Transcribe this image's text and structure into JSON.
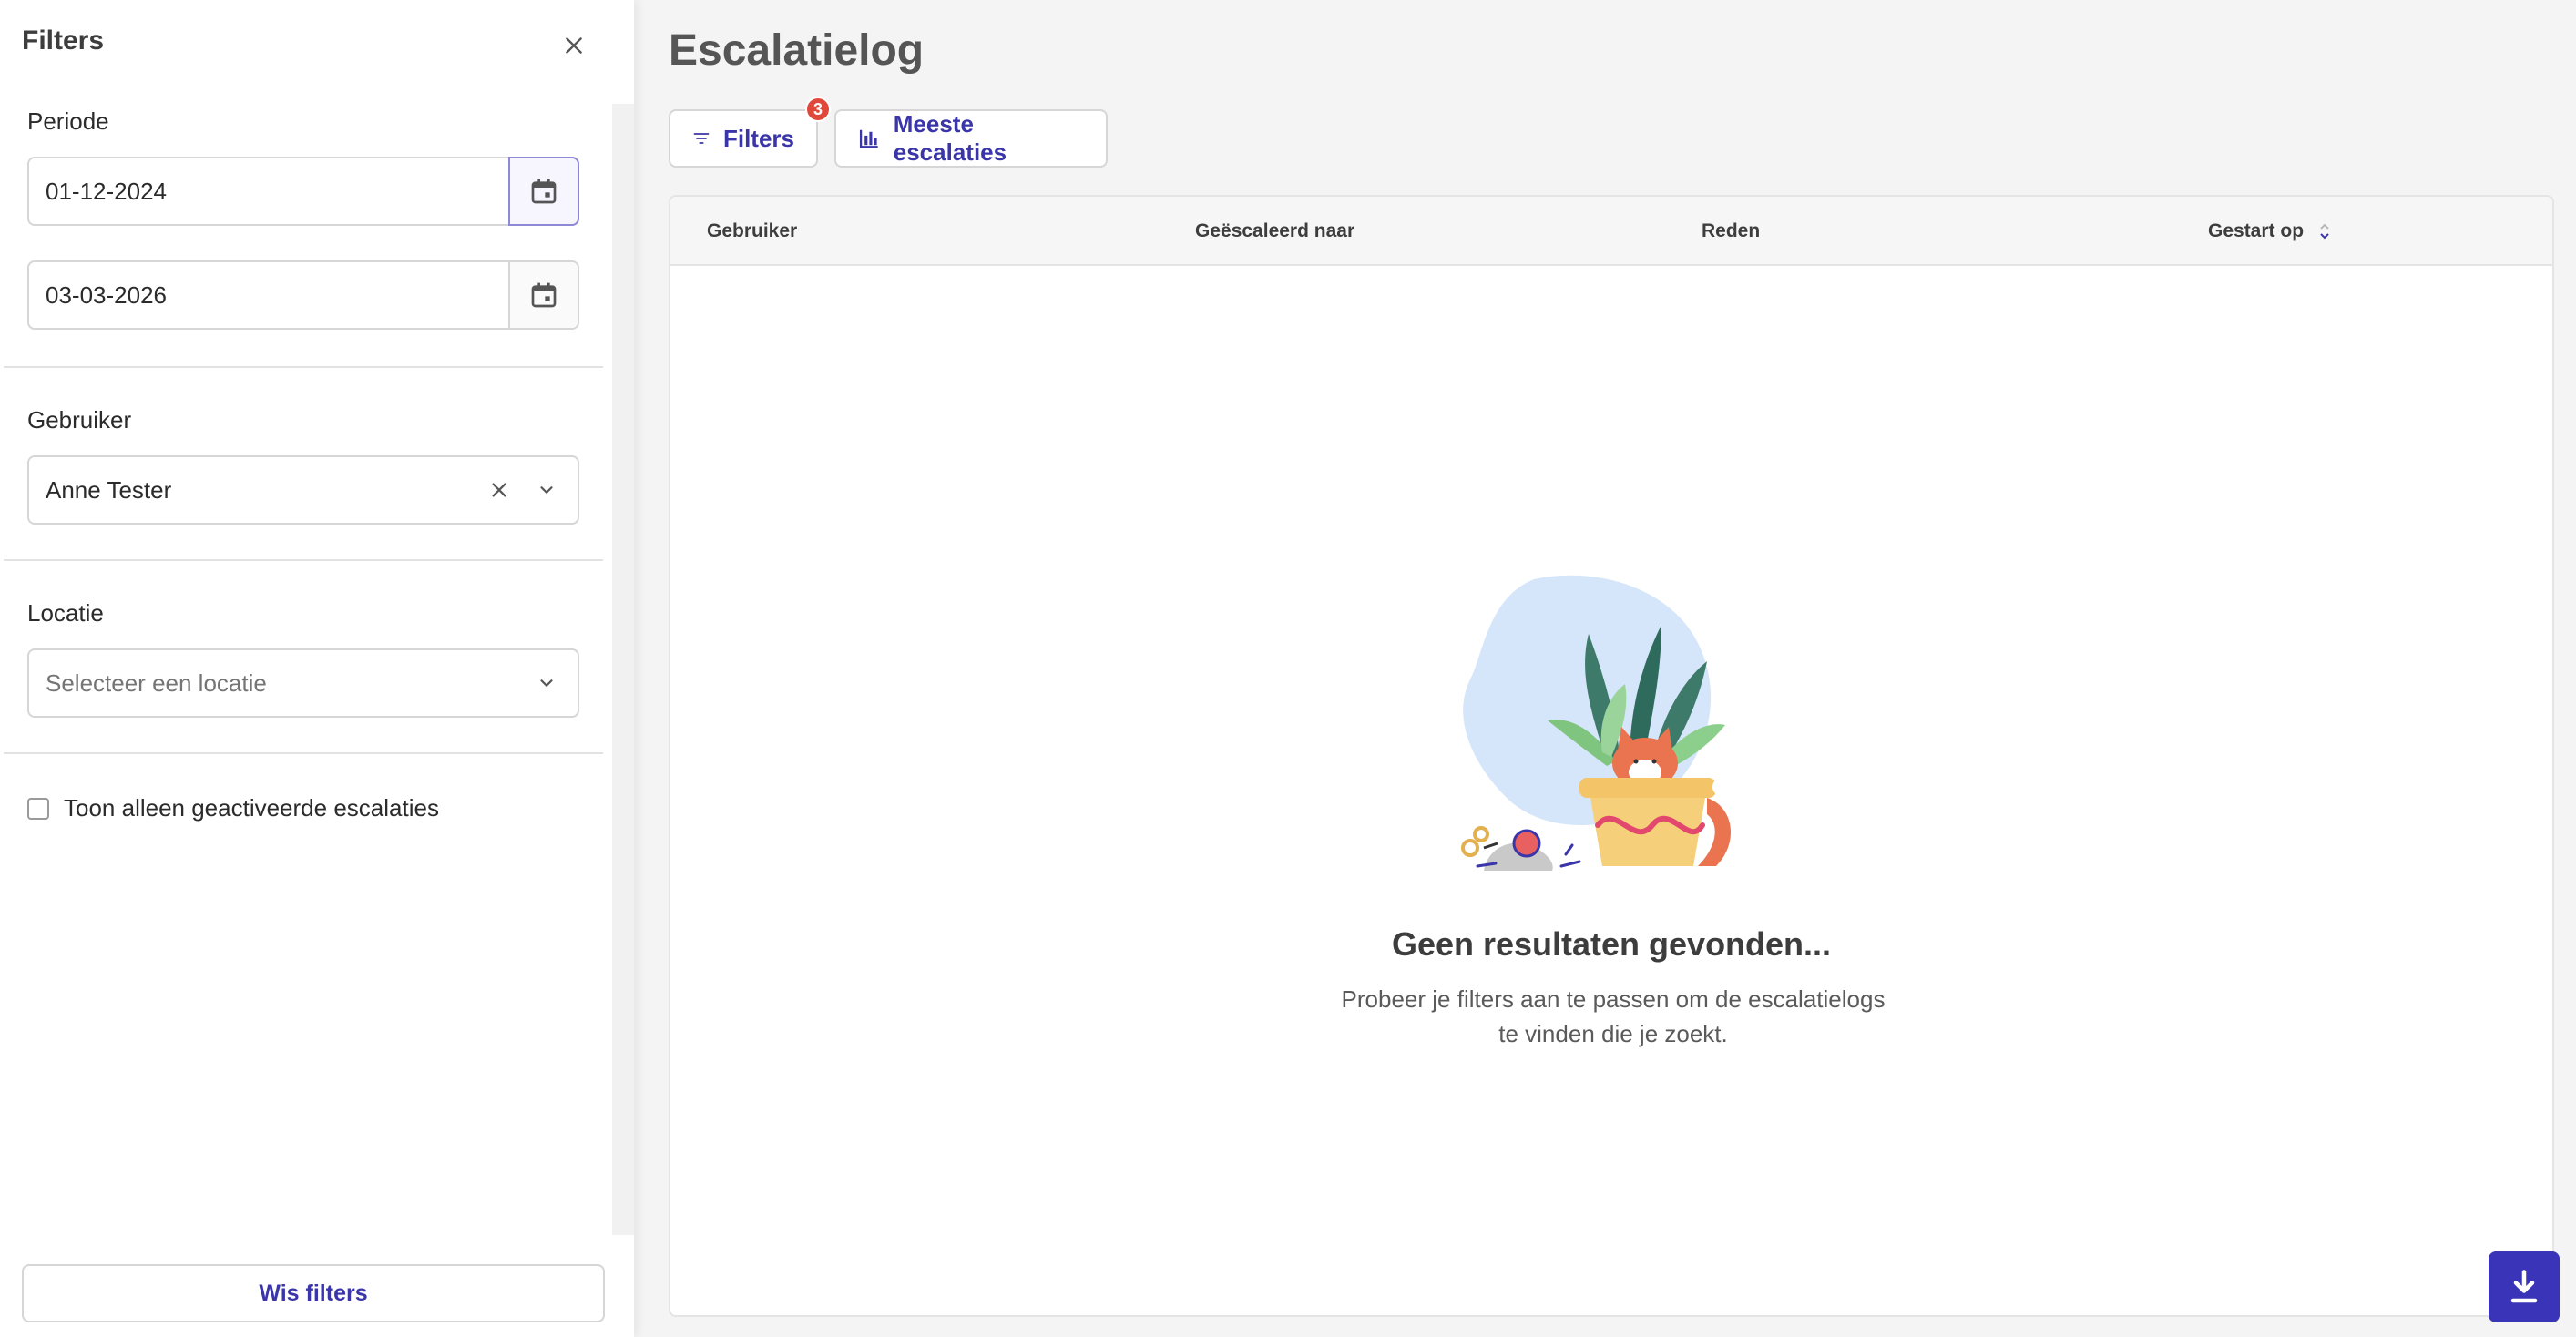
{
  "panel": {
    "title": "Filters",
    "close_icon": "close-icon",
    "period": {
      "label": "Periode",
      "start_date": "01-12-2024",
      "end_date": "03-03-2026",
      "calendar_icon": "calendar-icon"
    },
    "user": {
      "label": "Gebruiker",
      "value": "Anne Tester",
      "clear_icon": "close-icon",
      "dropdown_icon": "chevron-down-icon"
    },
    "location": {
      "label": "Locatie",
      "placeholder": "Selecteer een locatie",
      "dropdown_icon": "chevron-down-icon"
    },
    "activated_only": {
      "label": "Toon alleen geactiveerde escalaties",
      "checked": false
    },
    "clear_button": "Wis filters"
  },
  "main": {
    "title": "Escalatielog",
    "toolbar": {
      "filters_label": "Filters",
      "filters_badge": "3",
      "filters_icon": "filter-icon",
      "stats_label": "Meeste escalaties",
      "stats_icon": "bar-chart-icon"
    },
    "table": {
      "columns": [
        "Gebruiker",
        "Geëscaleerd naar",
        "Reden",
        "Gestart op"
      ],
      "sort_icon": "sort-icon",
      "rows": []
    },
    "empty_state": {
      "title": "Geen resultaten gevonden...",
      "description": "Probeer je filters aan te passen om de escalatielogs te vinden die je zoekt."
    },
    "download_icon": "download-icon"
  },
  "colors": {
    "accent": "#3a35a8",
    "badge": "#e0483c",
    "download_bg": "#3a35b8"
  }
}
